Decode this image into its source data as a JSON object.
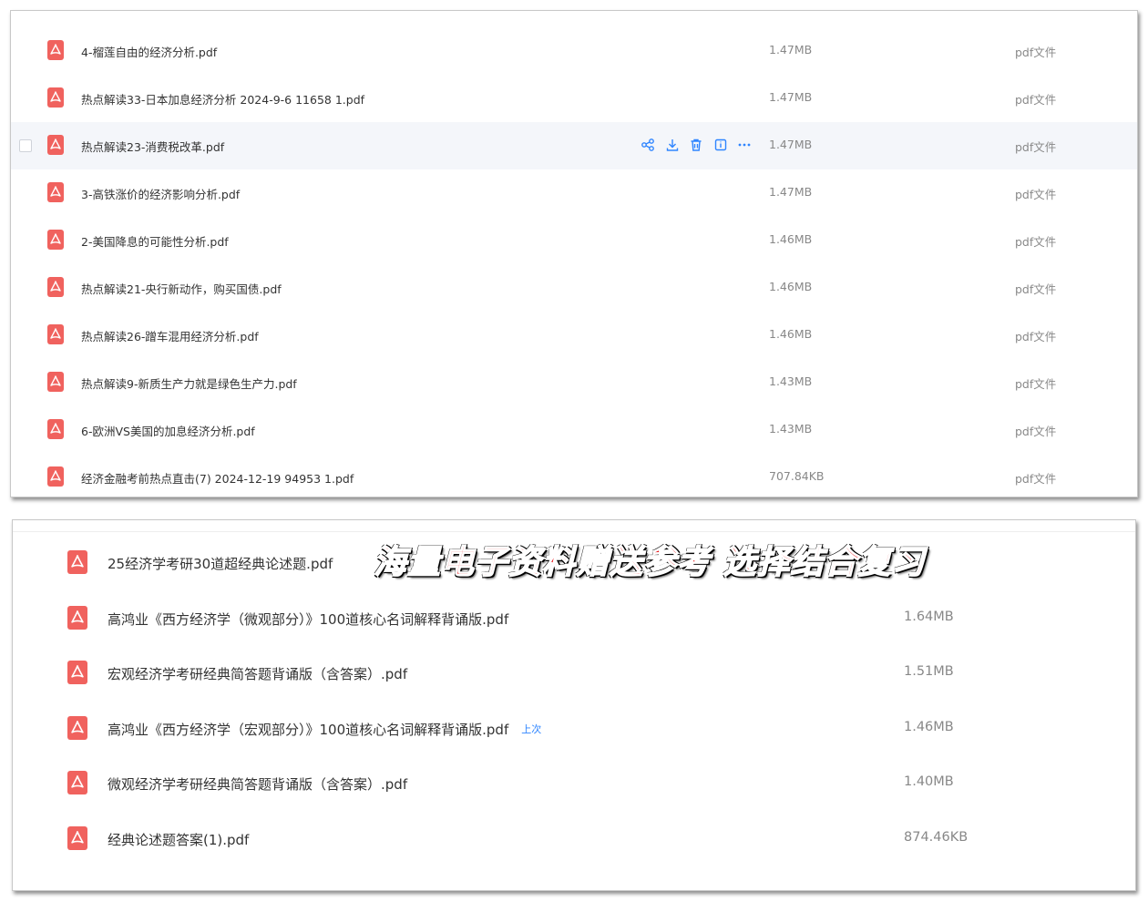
{
  "panel1": {
    "rows": [
      {
        "name": "4-榴莲自由的经济分析.pdf",
        "size": "1.47MB",
        "type": "pdf文件"
      },
      {
        "name": "热点解读33-日本加息经济分析 2024-9-6 11658 1.pdf",
        "size": "1.47MB",
        "type": "pdf文件"
      },
      {
        "name": "热点解读23-消费税改革.pdf",
        "size": "1.47MB",
        "type": "pdf文件"
      },
      {
        "name": "3-高铁涨价的经济影响分析.pdf",
        "size": "1.47MB",
        "type": "pdf文件"
      },
      {
        "name": "2-美国降息的可能性分析.pdf",
        "size": "1.46MB",
        "type": "pdf文件"
      },
      {
        "name": "热点解读21-央行新动作，购买国债.pdf",
        "size": "1.46MB",
        "type": "pdf文件"
      },
      {
        "name": "热点解读26-蹭车混用经济分析.pdf",
        "size": "1.46MB",
        "type": "pdf文件"
      },
      {
        "name": "热点解读9-新质生产力就是绿色生产力.pdf",
        "size": "1.43MB",
        "type": "pdf文件"
      },
      {
        "name": "6-欧洲VS美国的加息经济分析.pdf",
        "size": "1.43MB",
        "type": "pdf文件"
      },
      {
        "name": "经济金融考前热点直击(7) 2024-12-19 94953 1.pdf",
        "size": "707.84KB",
        "type": "pdf文件"
      }
    ],
    "hover_row_actions": [
      "share-icon",
      "download-icon",
      "delete-icon",
      "info-icon",
      "more-icon"
    ],
    "hover_row_index": 2
  },
  "banner": {
    "text": "海量电子资料赠送参考 选择结合复习",
    "color": "#e8151b"
  },
  "panel2": {
    "rows": [
      {
        "name": "25经济学考研30道超经典论述题.pdf",
        "size": ""
      },
      {
        "name": "高鸿业《西方经济学（微观部分）》100道核心名词解释背诵版.pdf",
        "size": "1.64MB"
      },
      {
        "name": "宏观经济学考研经典简答题背诵版（含答案）.pdf",
        "size": "1.51MB"
      },
      {
        "name": "高鸿业《西方经济学（宏观部分）》100道核心名词解释背诵版.pdf",
        "size": "1.46MB",
        "tag": "上次"
      },
      {
        "name": "微观经济学考研经典简答题背诵版（含答案）.pdf",
        "size": "1.40MB"
      },
      {
        "name": "经典论述题答案(1).pdf",
        "size": "874.46KB"
      }
    ]
  },
  "colors": {
    "pdf_icon": "#f0625e",
    "accent": "#2f85ff",
    "muted_text": "#888888"
  }
}
